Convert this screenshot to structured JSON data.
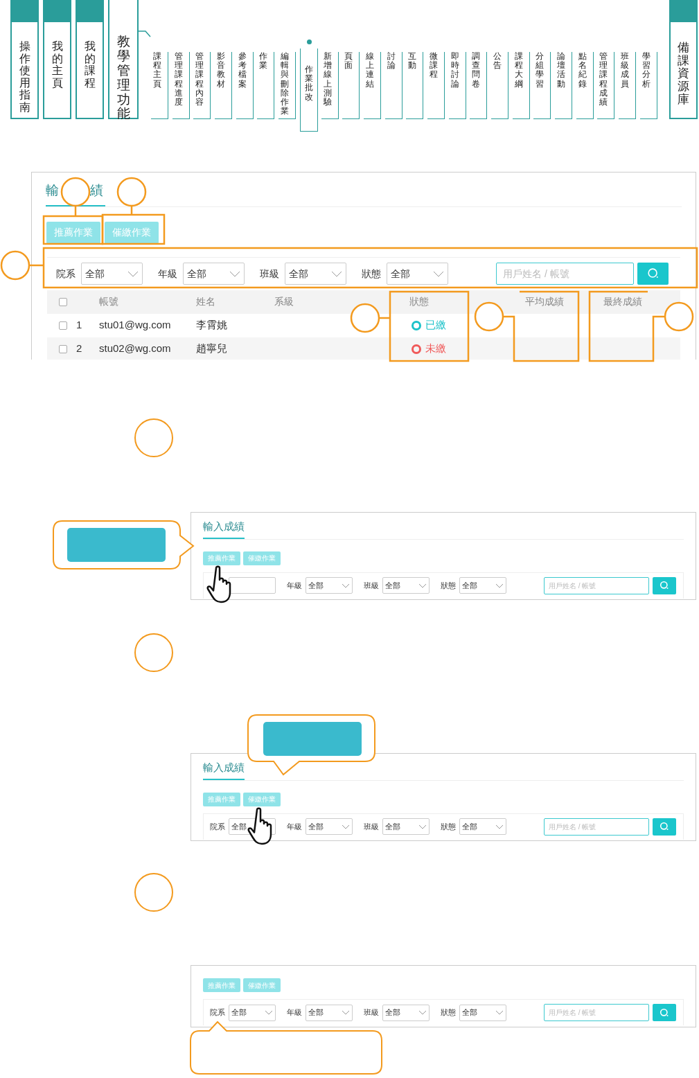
{
  "nav": {
    "main_tabs": [
      {
        "label": "操作使用指南",
        "selected": false
      },
      {
        "label": "我的主頁",
        "selected": false
      },
      {
        "label": "我的課程",
        "selected": false
      },
      {
        "label": "教學管理功能",
        "selected": true
      }
    ],
    "sub_items": [
      {
        "label": "課程主頁",
        "selected": false
      },
      {
        "label": "管理課程進度",
        "selected": false
      },
      {
        "label": "管理課程內容",
        "selected": false
      },
      {
        "label": "影音教材",
        "selected": false
      },
      {
        "label": "參考檔案",
        "selected": false
      },
      {
        "label": "作業",
        "selected": false
      },
      {
        "label": "編輯與刪除作業",
        "selected": false
      },
      {
        "label": "作業批改",
        "selected": true
      },
      {
        "label": "新增線上測驗",
        "selected": false
      },
      {
        "label": "頁面",
        "selected": false
      },
      {
        "label": "線上連結",
        "selected": false
      },
      {
        "label": "討論",
        "selected": false
      },
      {
        "label": "互動",
        "selected": false
      },
      {
        "label": "微課程",
        "selected": false
      },
      {
        "label": "即時討論",
        "selected": false
      },
      {
        "label": "調查問卷",
        "selected": false
      },
      {
        "label": "公告",
        "selected": false
      },
      {
        "label": "課程大綱",
        "selected": false
      },
      {
        "label": "分組學習",
        "selected": false
      },
      {
        "label": "論壇活動",
        "selected": false
      },
      {
        "label": "點名紀錄",
        "selected": false
      },
      {
        "label": "管理課程成績",
        "selected": false
      },
      {
        "label": "班級成員",
        "selected": false
      },
      {
        "label": "學習分析",
        "selected": false
      }
    ],
    "resource_tab": {
      "label": "備課資源庫",
      "selected": false
    }
  },
  "grade_panel": {
    "title_fragments": [
      "輸",
      "績"
    ],
    "buttons": [
      "推薦作業",
      "催繳作業"
    ],
    "filters": [
      {
        "label": "院系",
        "value": "全部"
      },
      {
        "label": "年級",
        "value": "全部"
      },
      {
        "label": "班級",
        "value": "全部"
      },
      {
        "label": "狀態",
        "value": "全部"
      }
    ],
    "search": {
      "placeholder": "用戶姓名 / 帳號"
    },
    "select_all": {
      "checked": false
    },
    "columns": [
      "帳號",
      "姓名",
      "系級",
      "狀態",
      "平均成績",
      "最終成績"
    ],
    "rows": [
      {
        "checked": false,
        "index": "1",
        "account": "stu01@wg.com",
        "name": "李霄姚",
        "status": "已繳",
        "color": "#1cc2c9"
      },
      {
        "checked": false,
        "index": "2",
        "account": "stu02@wg.com",
        "name": "趙寧兒",
        "status": "未繳",
        "color": "#f05a5a"
      }
    ]
  },
  "steps": [
    {
      "kind": "left",
      "panel": {
        "title": "輸入成績",
        "buttons": [
          "推薦作業",
          "催繳作業"
        ],
        "filters": [
          {
            "kind": "covered"
          },
          {
            "label": "年級",
            "value": "全部"
          },
          {
            "label": "班級",
            "value": "全部"
          },
          {
            "label": "狀態",
            "value": "全部"
          }
        ],
        "search": {
          "placeholder": "用戶姓名 / 帳號"
        }
      }
    },
    {
      "kind": "above",
      "panel": {
        "title": "輸入成績",
        "buttons": [
          "推薦作業",
          "催繳作業"
        ],
        "filters": [
          {
            "kind": "partly-covered",
            "label": "院系",
            "value": "全部"
          },
          {
            "label": "年級",
            "value": "全部"
          },
          {
            "label": "班級",
            "value": "全部"
          },
          {
            "label": "狀態",
            "value": "全部"
          }
        ],
        "search": {
          "placeholder": "用戶姓名 / 帳號"
        }
      }
    },
    {
      "kind": "below",
      "panel": {
        "buttons": [
          "推薦作業",
          "催繳作業"
        ],
        "filters": [
          {
            "label": "院系",
            "value": "全部"
          },
          {
            "label": "年級",
            "value": "全部"
          },
          {
            "label": "班級",
            "value": "全部"
          },
          {
            "label": "狀態",
            "value": "全部"
          }
        ],
        "search": {
          "placeholder": "用戶姓名 / 帳號"
        }
      }
    }
  ]
}
